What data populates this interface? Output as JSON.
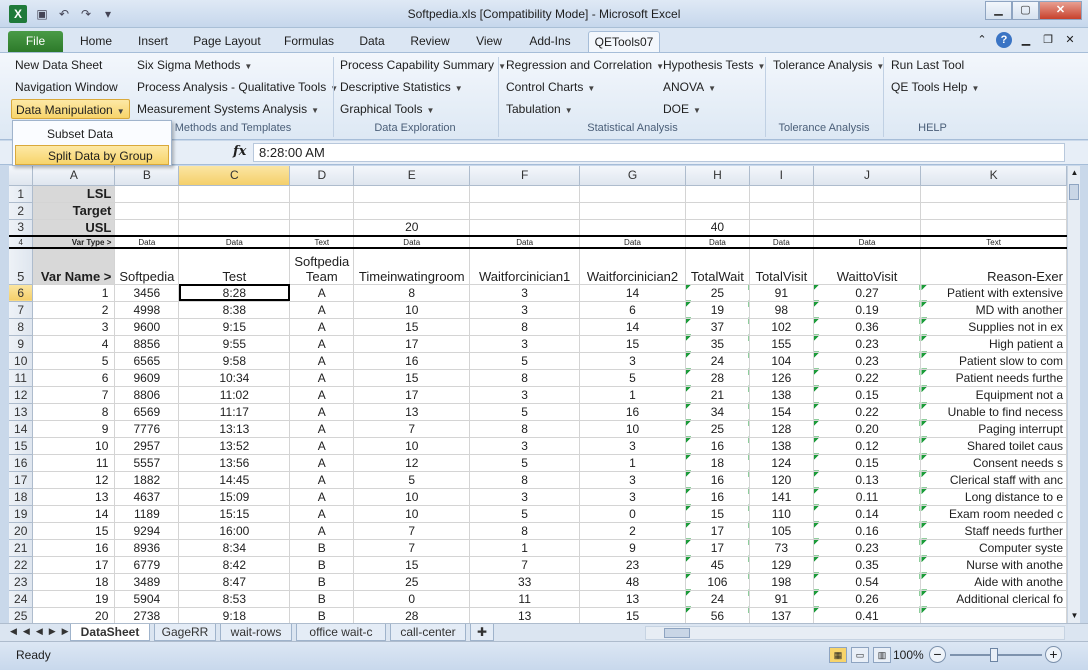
{
  "app": {
    "title": "Softpedia.xls  [Compatibility Mode]  -  Microsoft Excel",
    "logo_letter": "X",
    "qat_icons": [
      "save-icon",
      "undo-icon",
      "redo-icon",
      "customize-icon"
    ]
  },
  "tabs": [
    "File",
    "Home",
    "Insert",
    "Page Layout",
    "Formulas",
    "Data",
    "Review",
    "View",
    "Add-Ins",
    "QETools07"
  ],
  "active_tab": "QETools07",
  "ribbon": {
    "col1": [
      "New Data Sheet",
      "Navigation Window",
      "Data Manipulation"
    ],
    "col2": [
      "Six Sigma Methods",
      "Process Analysis - Qualitative Tools",
      "Measurement Systems Analysis"
    ],
    "col3": [
      "Process Capability Summary",
      "Descriptive Statistics",
      "Graphical Tools"
    ],
    "col4": [
      "Regression and Correlation",
      "Control Charts",
      "Tabulation"
    ],
    "col5": [
      "Hypothesis Tests",
      "ANOVA",
      "DOE"
    ],
    "col6": [
      "Tolerance Analysis"
    ],
    "col7": [
      "Run Last Tool",
      "QE Tools Help"
    ],
    "groups": [
      "Methods and Templates",
      "Data Exploration",
      "Statistical Analysis",
      "Tolerance Analysis",
      "HELP"
    ]
  },
  "dropdown": {
    "items": [
      "Subset Data",
      "Split Data by Group"
    ],
    "selected": "Split Data by Group"
  },
  "formula_bar": {
    "fx": "fx",
    "value": "8:28:00 AM"
  },
  "grid": {
    "columns": [
      "A",
      "B",
      "C",
      "D",
      "E",
      "F",
      "G",
      "H",
      "I",
      "J",
      "K"
    ],
    "selected_column": "C",
    "selected_row": "6",
    "row_labels": [
      "LSL",
      "Target",
      "USL"
    ],
    "usl_values": {
      "E": "20",
      "H": "40"
    },
    "var_type_label": "Var Type >",
    "var_types": [
      "Data",
      "Data",
      "Text",
      "Data",
      "Data",
      "Data",
      "Data",
      "Data",
      "Data",
      "Text"
    ],
    "var_name_label": "Var Name >",
    "headers": [
      "Softpedia",
      "Test",
      "Softpedia Team",
      "Timeinwatingroom",
      "Waitforcinician1",
      "Waitforcinician2",
      "TotalWait",
      "TotalVisit",
      "WaittoVisit",
      "Reason-Exer"
    ],
    "rows": [
      [
        "6",
        "1",
        "3456",
        "8:28",
        "A",
        "8",
        "3",
        "14",
        "25",
        "91",
        "0.27",
        "Patient with extensive"
      ],
      [
        "7",
        "2",
        "4998",
        "8:38",
        "A",
        "10",
        "3",
        "6",
        "19",
        "98",
        "0.19",
        "MD with another"
      ],
      [
        "8",
        "3",
        "9600",
        "9:15",
        "A",
        "15",
        "8",
        "14",
        "37",
        "102",
        "0.36",
        "Supplies not in ex"
      ],
      [
        "9",
        "4",
        "8856",
        "9:55",
        "A",
        "17",
        "3",
        "15",
        "35",
        "155",
        "0.23",
        "High patient a"
      ],
      [
        "10",
        "5",
        "6565",
        "9:58",
        "A",
        "16",
        "5",
        "3",
        "24",
        "104",
        "0.23",
        "Patient slow to com"
      ],
      [
        "11",
        "6",
        "9609",
        "10:34",
        "A",
        "15",
        "8",
        "5",
        "28",
        "126",
        "0.22",
        "Patient needs furthe"
      ],
      [
        "12",
        "7",
        "8806",
        "11:02",
        "A",
        "17",
        "3",
        "1",
        "21",
        "138",
        "0.15",
        "Equipment not a"
      ],
      [
        "13",
        "8",
        "6569",
        "11:17",
        "A",
        "13",
        "5",
        "16",
        "34",
        "154",
        "0.22",
        "Unable to find necess"
      ],
      [
        "14",
        "9",
        "7776",
        "13:13",
        "A",
        "7",
        "8",
        "10",
        "25",
        "128",
        "0.20",
        "Paging interrupt"
      ],
      [
        "15",
        "10",
        "2957",
        "13:52",
        "A",
        "10",
        "3",
        "3",
        "16",
        "138",
        "0.12",
        "Shared toilet caus"
      ],
      [
        "16",
        "11",
        "5557",
        "13:56",
        "A",
        "12",
        "5",
        "1",
        "18",
        "124",
        "0.15",
        "Consent needs s"
      ],
      [
        "17",
        "12",
        "1882",
        "14:45",
        "A",
        "5",
        "8",
        "3",
        "16",
        "120",
        "0.13",
        "Clerical staff with anc"
      ],
      [
        "18",
        "13",
        "4637",
        "15:09",
        "A",
        "10",
        "3",
        "3",
        "16",
        "141",
        "0.11",
        "Long distance to e"
      ],
      [
        "19",
        "14",
        "1189",
        "15:15",
        "A",
        "10",
        "5",
        "0",
        "15",
        "110",
        "0.14",
        "Exam room needed c"
      ],
      [
        "20",
        "15",
        "9294",
        "16:00",
        "A",
        "7",
        "8",
        "2",
        "17",
        "105",
        "0.16",
        "Staff needs further"
      ],
      [
        "21",
        "16",
        "8936",
        "8:34",
        "B",
        "7",
        "1",
        "9",
        "17",
        "73",
        "0.23",
        "Computer syste"
      ],
      [
        "22",
        "17",
        "6779",
        "8:42",
        "B",
        "15",
        "7",
        "23",
        "45",
        "129",
        "0.35",
        "Nurse with anothe"
      ],
      [
        "23",
        "18",
        "3489",
        "8:47",
        "B",
        "25",
        "33",
        "48",
        "106",
        "198",
        "0.54",
        "Aide with anothe"
      ],
      [
        "24",
        "19",
        "5904",
        "8:53",
        "B",
        "0",
        "11",
        "13",
        "24",
        "91",
        "0.26",
        "Additional clerical fo"
      ],
      [
        "25",
        "20",
        "2738",
        "9:18",
        "B",
        "28",
        "13",
        "15",
        "56",
        "137",
        "0.41",
        ""
      ]
    ]
  },
  "sheets": [
    "DataSheet",
    "GageRR",
    "wait-rows",
    "office wait-c",
    "call-center"
  ],
  "active_sheet": "DataSheet",
  "status": {
    "ready": "Ready",
    "zoom": "100%"
  }
}
